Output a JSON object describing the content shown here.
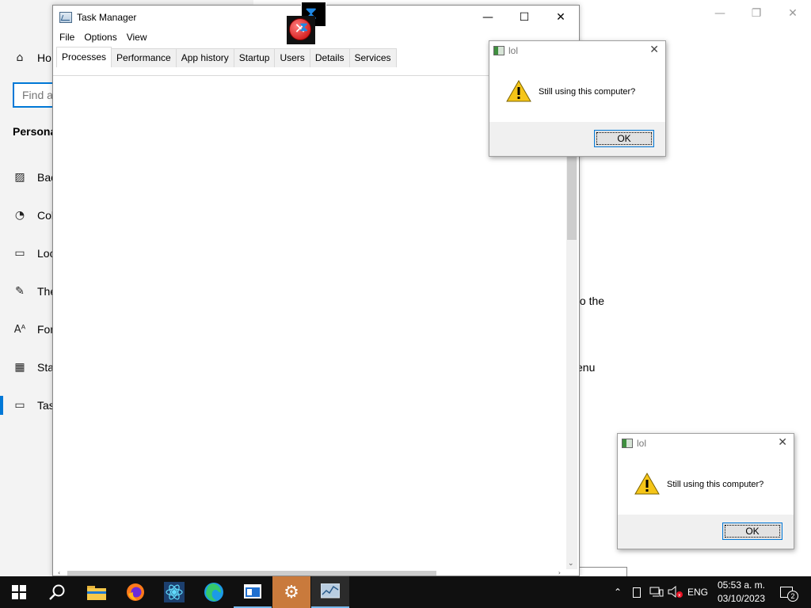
{
  "settings_window": {
    "nav_home_label": "Ho",
    "search_placeholder": "Find a",
    "section_title": "Persona",
    "nav_items": [
      {
        "label": "Bac",
        "icon": "picture-icon"
      },
      {
        "label": "Col",
        "icon": "palette-icon"
      },
      {
        "label": "Loc",
        "icon": "lock-screen-icon"
      },
      {
        "label": "The",
        "icon": "themes-icon"
      },
      {
        "label": "Fon",
        "icon": "fonts-icon"
      },
      {
        "label": "Sta",
        "icon": "start-icon"
      },
      {
        "label": "Tas",
        "icon": "taskbar-icon"
      }
    ],
    "content_fragment_1": "to the",
    "content_fragment_2": "enu"
  },
  "task_manager": {
    "title": "Task Manager",
    "menu": [
      "File",
      "Options",
      "View"
    ],
    "tabs": [
      "Processes",
      "Performance",
      "App history",
      "Startup",
      "Users",
      "Details",
      "Services"
    ],
    "active_tab": "Processes"
  },
  "dialogs": [
    {
      "title": "lol",
      "message": "Still using this computer?",
      "ok_label": "OK"
    },
    {
      "title": "lol",
      "message": "Still using this computer?",
      "ok_label": "OK"
    }
  ],
  "taskbar": {
    "apps": [
      "start-icon",
      "search-icon",
      "file-explorer-icon",
      "firefox-icon",
      "app-icon",
      "edge-icon",
      "window-icon",
      "settings-icon",
      "task-manager-icon"
    ],
    "language": "ENG",
    "time": "05:53 a. m.",
    "date": "03/10/2023",
    "notification_count": "2"
  },
  "colors": {
    "accent": "#0078d7",
    "taskbar": "#101010",
    "active_taskbar_app": "#c97a3c"
  }
}
